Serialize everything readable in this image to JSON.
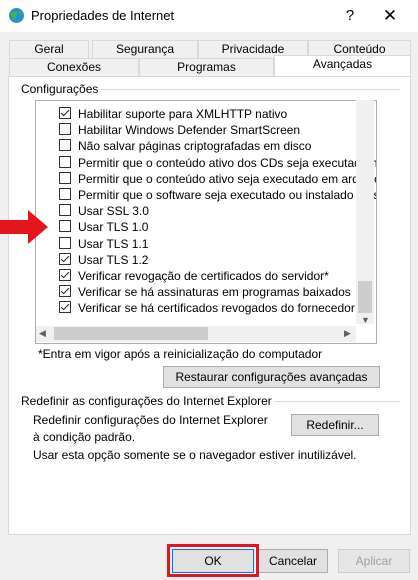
{
  "window": {
    "title": "Propriedades de Internet",
    "help_glyph": "?",
    "close_glyph": "✕"
  },
  "tabs": {
    "row1": [
      "Geral",
      "Segurança",
      "Privacidade",
      "Conteúdo"
    ],
    "row2": [
      "Conexões",
      "Programas",
      "Avançadas"
    ],
    "selected": "Avançadas"
  },
  "settings": {
    "group_label": "Configurações",
    "items": [
      {
        "label": "Habilitar suporte para XMLHTTP nativo",
        "checked": true
      },
      {
        "label": "Habilitar Windows Defender SmartScreen",
        "checked": false
      },
      {
        "label": "Não salvar páginas criptografadas em disco",
        "checked": false
      },
      {
        "label": "Permitir que o conteúdo ativo dos CDs seja executado no",
        "checked": false
      },
      {
        "label": "Permitir que o conteúdo ativo seja executado em arquivos",
        "checked": false
      },
      {
        "label": "Permitir que o software seja executado ou instalado mesm",
        "checked": false
      },
      {
        "label": "Usar SSL 3.0",
        "checked": false
      },
      {
        "label": "Usar TLS 1.0",
        "checked": false
      },
      {
        "label": "Usar TLS 1.1",
        "checked": false
      },
      {
        "label": "Usar TLS 1.2",
        "checked": true
      },
      {
        "label": "Verificar revogação de certificados do servidor*",
        "checked": true
      },
      {
        "label": "Verificar se há assinaturas em programas baixados",
        "checked": true
      },
      {
        "label": "Verificar se há certificados revogados do fornecedor",
        "checked": true
      }
    ],
    "note": "*Entra em vigor após a reinicialização do computador",
    "restore_button": "Restaurar configurações avançadas"
  },
  "reset": {
    "group_label": "Redefinir as configurações do Internet Explorer",
    "description": "Redefinir configurações do Internet Explorer à condição padrão.",
    "button": "Redefinir...",
    "hint": "Usar esta opção somente se o navegador estiver inutilizável."
  },
  "footer": {
    "ok": "OK",
    "cancel": "Cancelar",
    "apply": "Aplicar"
  },
  "colors": {
    "annotation_red": "#e3161e",
    "panel_bg": "#ffffff",
    "window_bg": "#f0f0f0"
  }
}
